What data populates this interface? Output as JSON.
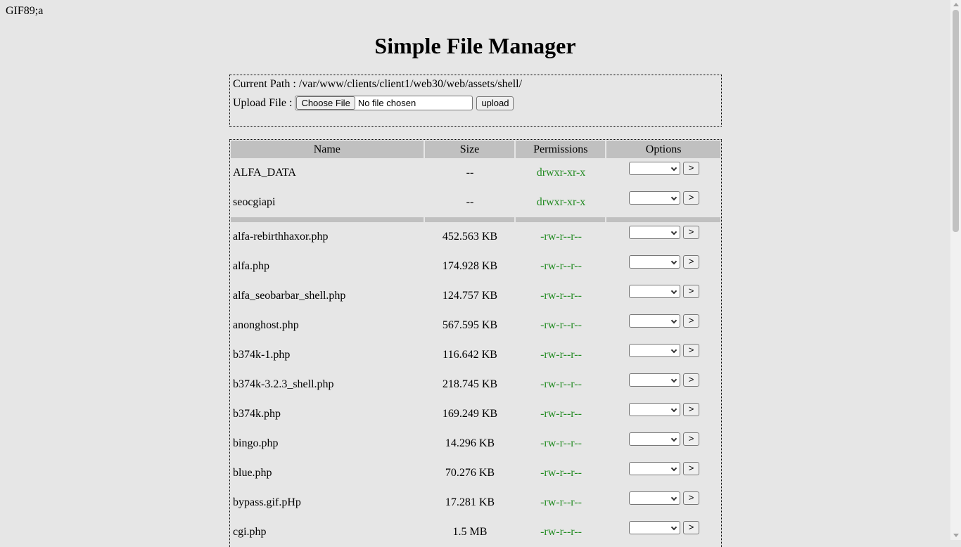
{
  "header": {
    "gif_marker": "GIF89;a",
    "title": "Simple File Manager"
  },
  "upload_panel": {
    "current_path_label": "Current Path :",
    "current_path": "/var/www/clients/client1/web30/web/assets/shell/",
    "upload_label": "Upload File :",
    "choose_file_label": "Choose File",
    "file_status": "No file chosen",
    "upload_button": "upload"
  },
  "table": {
    "columns": [
      "Name",
      "Size",
      "Permissions",
      "Options"
    ],
    "go_label": ">",
    "directories": [
      {
        "name": "ALFA_DATA",
        "size": "--",
        "perm": "drwxr-xr-x"
      },
      {
        "name": "seocgiapi",
        "size": "--",
        "perm": "drwxr-xr-x"
      }
    ],
    "files": [
      {
        "name": "alfa-rebirthhaxor.php",
        "size": "452.563 KB",
        "perm": "-rw-r--r--"
      },
      {
        "name": "alfa.php",
        "size": "174.928 KB",
        "perm": "-rw-r--r--"
      },
      {
        "name": "alfa_seobarbar_shell.php",
        "size": "124.757 KB",
        "perm": "-rw-r--r--"
      },
      {
        "name": "anonghost.php",
        "size": "567.595 KB",
        "perm": "-rw-r--r--"
      },
      {
        "name": "b374k-1.php",
        "size": "116.642 KB",
        "perm": "-rw-r--r--"
      },
      {
        "name": "b374k-3.2.3_shell.php",
        "size": "218.745 KB",
        "perm": "-rw-r--r--"
      },
      {
        "name": "b374k.php",
        "size": "169.249 KB",
        "perm": "-rw-r--r--"
      },
      {
        "name": "bingo.php",
        "size": "14.296 KB",
        "perm": "-rw-r--r--"
      },
      {
        "name": "blue.php",
        "size": "70.276 KB",
        "perm": "-rw-r--r--"
      },
      {
        "name": "bypass.gif.pHp",
        "size": "17.281 KB",
        "perm": "-rw-r--r--"
      },
      {
        "name": "cgi.php",
        "size": "1.5 MB",
        "perm": "-rw-r--r--"
      }
    ]
  },
  "colors": {
    "background": "#e6e6e6",
    "header_cell": "#c0c0c0",
    "permission_text": "#228b22"
  }
}
